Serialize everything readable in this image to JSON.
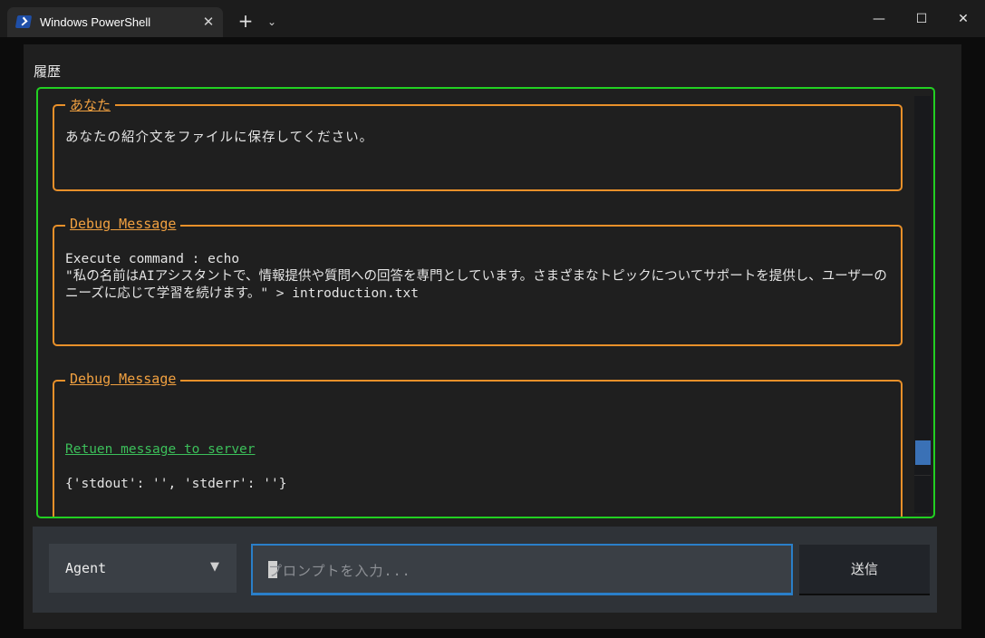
{
  "window": {
    "tab_title": "Windows PowerShell",
    "tab_close": "✕",
    "new_tab": "+",
    "tab_dropdown": "⌄",
    "minimize": "—",
    "maximize": "☐",
    "close": "✕"
  },
  "history": {
    "label": "履歴",
    "messages": [
      {
        "title": "あなた",
        "body": "あなたの紹介文をファイルに保存してください。"
      },
      {
        "title": "Debug Message",
        "body": "Execute command : echo\n\"私の名前はAIアシスタントで、情報提供や質問への回答を専門としています。さまざまなトピックについてサポートを提供し、ユーザーのニーズに応じて学習を続けます。\" > introduction.txt"
      },
      {
        "title": "Debug Message",
        "link": "Retuen message to server",
        "body": "{'stdout': '', 'stderr': ''}"
      }
    ]
  },
  "input": {
    "agent_select": "Agent",
    "agent_caret": "▼",
    "prompt_placeholder": "プロンプトを入力...",
    "send_label": "送信"
  },
  "colors": {
    "history_border": "#22d022",
    "message_border": "#e8902a",
    "link_green": "#3cbf5a",
    "focus_blue": "#2a7fc9"
  }
}
